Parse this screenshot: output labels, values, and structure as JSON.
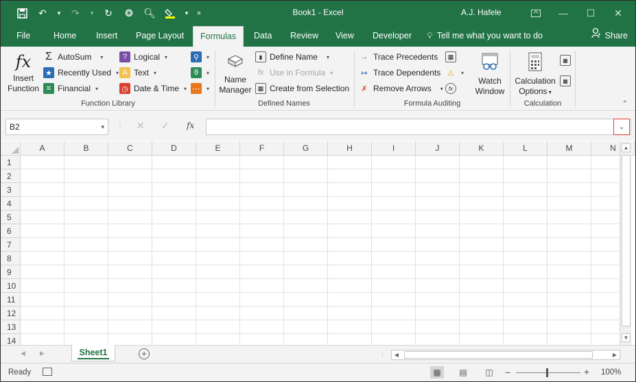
{
  "window": {
    "doc_title": "Book1 - Excel",
    "user": "A.J. Hafele",
    "accent": "#217346"
  },
  "tabs": [
    {
      "label": "File"
    },
    {
      "label": "Home"
    },
    {
      "label": "Insert"
    },
    {
      "label": "Page Layout"
    },
    {
      "label": "Formulas"
    },
    {
      "label": "Data"
    },
    {
      "label": "Review"
    },
    {
      "label": "View"
    },
    {
      "label": "Developer"
    }
  ],
  "tell_me": "Tell me what you want to do",
  "share": "Share",
  "ribbon": {
    "insert_function": {
      "line1": "Insert",
      "line2": "Function"
    },
    "autosum": "AutoSum",
    "recently_used": "Recently Used",
    "financial": "Financial",
    "logical": "Logical",
    "text": "Text",
    "date_time": "Date & Time",
    "function_library": "Function Library",
    "name_manager": {
      "line1": "Name",
      "line2": "Manager"
    },
    "define_name": "Define Name",
    "use_in_formula": "Use in Formula",
    "create_from_selection": "Create from Selection",
    "defined_names": "Defined Names",
    "trace_precedents": "Trace Precedents",
    "trace_dependents": "Trace Dependents",
    "remove_arrows": "Remove Arrows",
    "watch_window": {
      "line1": "Watch",
      "line2": "Window"
    },
    "formula_auditing": "Formula Auditing",
    "calculation_options": {
      "line1": "Calculation",
      "line2": "Options"
    },
    "calculation": "Calculation"
  },
  "formula_bar": {
    "name_box": "B2",
    "fx": "fx",
    "value": ""
  },
  "columns": [
    "A",
    "B",
    "C",
    "D",
    "E",
    "F",
    "G",
    "H",
    "I",
    "J",
    "K",
    "L",
    "M",
    "N"
  ],
  "rows": [
    "1",
    "2",
    "3",
    "4",
    "5",
    "6",
    "7",
    "8",
    "9",
    "10",
    "11",
    "12",
    "13",
    "14"
  ],
  "sheets": [
    {
      "label": "Sheet1",
      "active": true
    }
  ],
  "status": {
    "text": "Ready",
    "zoom": "100%"
  }
}
